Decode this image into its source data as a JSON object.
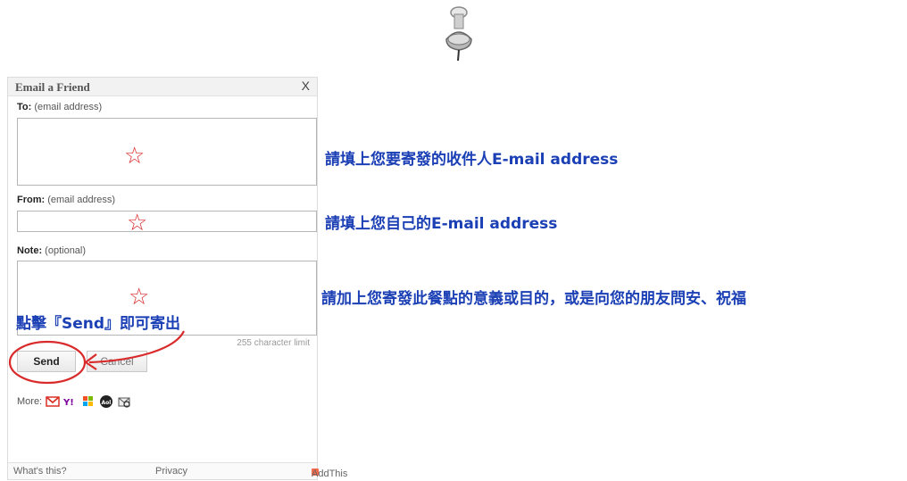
{
  "dialog": {
    "title": "Email a Friend",
    "close": "X",
    "to": {
      "label": "To:",
      "hint": "(email address)"
    },
    "from": {
      "label": "From:",
      "hint": "(email address)"
    },
    "note": {
      "label": "Note:",
      "hint": "(optional)"
    },
    "char_limit": "255 character limit",
    "send": "Send",
    "cancel": "Cancel",
    "more": "More:",
    "services": [
      "gmail-icon",
      "yahoo-icon",
      "windows-live-icon",
      "aol-icon",
      "email-client-icon"
    ],
    "footer": {
      "whats_this": "What's this?",
      "privacy": "Privacy",
      "addthis": "AddThis"
    }
  },
  "annotations": {
    "to": "請填上您要寄發的收件人E-mail address",
    "from": "請填上您自己的E-mail address",
    "note": "請加上您寄發此餐點的意義或目的，或是向您的朋友問安、祝福",
    "send": "點擊『Send』即可寄出"
  },
  "colors": {
    "annotation_text": "#1b3fb5",
    "marker_red": "#d92b2b"
  }
}
